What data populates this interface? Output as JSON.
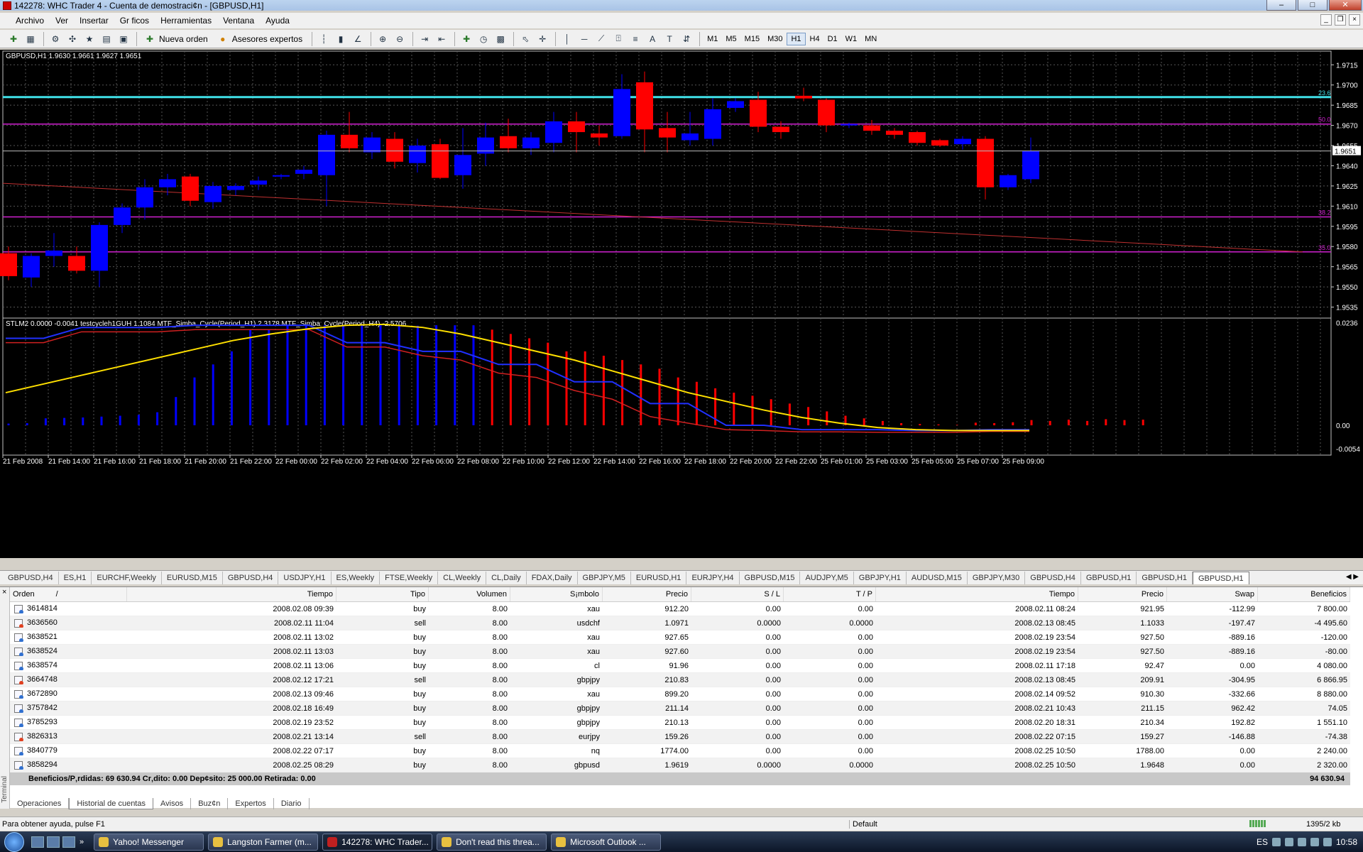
{
  "window": {
    "title": "142278: WHC Trader 4 - Cuenta de demostraci¢n - [GBPUSD,H1]"
  },
  "menu": [
    "Archivo",
    "Ver",
    "Insertar",
    "Gr ficos",
    "Herramientas",
    "Ventana",
    "Ayuda"
  ],
  "toolbar": {
    "new_order": "Nueva orden",
    "experts": "Asesores expertos",
    "timeframes": [
      "M1",
      "M5",
      "M15",
      "M30",
      "H1",
      "H4",
      "D1",
      "W1",
      "MN"
    ],
    "active_timeframe": "H1"
  },
  "chart_data": [
    {
      "type": "candlestick",
      "header": "GBPUSD,H1  1.9630 1.9661 1.9627 1.9651",
      "y_ticks": [
        "1.9715",
        "1.9700",
        "1.9685",
        "1.9670",
        "1.9655",
        "1.9640",
        "1.9625",
        "1.9610",
        "1.9595",
        "1.9580",
        "1.9565",
        "1.9550",
        "1.9535"
      ],
      "ylim": [
        1.953,
        1.9722
      ],
      "current_price": "1.9651",
      "fib_labels": [
        "23.6",
        "50.0",
        "38.2",
        "35.0"
      ],
      "levels": [
        {
          "label": "23.6",
          "value": 1.9691,
          "color": "#40e0e8"
        },
        {
          "label": "50.0",
          "value": 1.9671,
          "color": "#d020d0"
        },
        {
          "label": "38.2",
          "value": 1.9602,
          "color": "#d020d0"
        },
        {
          "label": "35.0",
          "value": 1.9576,
          "color": "#d020d0"
        }
      ],
      "trendline": {
        "from": 1.9627,
        "to": 1.9576,
        "color": "#c03030"
      },
      "candles": [
        {
          "o": 1.9575,
          "h": 1.958,
          "l": 1.9555,
          "c": 1.9558
        },
        {
          "o": 1.9557,
          "h": 1.9575,
          "l": 1.955,
          "c": 1.9573
        },
        {
          "o": 1.9573,
          "h": 1.959,
          "l": 1.9565,
          "c": 1.9577
        },
        {
          "o": 1.9573,
          "h": 1.958,
          "l": 1.956,
          "c": 1.9562
        },
        {
          "o": 1.9562,
          "h": 1.9598,
          "l": 1.955,
          "c": 1.9596
        },
        {
          "o": 1.9596,
          "h": 1.9612,
          "l": 1.959,
          "c": 1.9609
        },
        {
          "o": 1.9609,
          "h": 1.963,
          "l": 1.96,
          "c": 1.9624
        },
        {
          "o": 1.9624,
          "h": 1.9634,
          "l": 1.9618,
          "c": 1.963
        },
        {
          "o": 1.9632,
          "h": 1.9634,
          "l": 1.961,
          "c": 1.9614
        },
        {
          "o": 1.9613,
          "h": 1.9628,
          "l": 1.9608,
          "c": 1.9625
        },
        {
          "o": 1.9622,
          "h": 1.9627,
          "l": 1.9618,
          "c": 1.9625
        },
        {
          "o": 1.9626,
          "h": 1.9632,
          "l": 1.9622,
          "c": 1.9629
        },
        {
          "o": 1.9632,
          "h": 1.9634,
          "l": 1.963,
          "c": 1.9633
        },
        {
          "o": 1.9634,
          "h": 1.964,
          "l": 1.963,
          "c": 1.9637
        },
        {
          "o": 1.9633,
          "h": 1.9666,
          "l": 1.961,
          "c": 1.9663
        },
        {
          "o": 1.9663,
          "h": 1.968,
          "l": 1.965,
          "c": 1.9653
        },
        {
          "o": 1.965,
          "h": 1.9665,
          "l": 1.9645,
          "c": 1.9661
        },
        {
          "o": 1.966,
          "h": 1.9665,
          "l": 1.9638,
          "c": 1.9643
        },
        {
          "o": 1.9642,
          "h": 1.966,
          "l": 1.9635,
          "c": 1.9655
        },
        {
          "o": 1.9656,
          "h": 1.966,
          "l": 1.963,
          "c": 1.9631
        },
        {
          "o": 1.9633,
          "h": 1.9668,
          "l": 1.9623,
          "c": 1.9648
        },
        {
          "o": 1.9649,
          "h": 1.9672,
          "l": 1.964,
          "c": 1.9661
        },
        {
          "o": 1.9662,
          "h": 1.9675,
          "l": 1.965,
          "c": 1.9653
        },
        {
          "o": 1.9653,
          "h": 1.9665,
          "l": 1.9648,
          "c": 1.9661
        },
        {
          "o": 1.9657,
          "h": 1.968,
          "l": 1.965,
          "c": 1.9673
        },
        {
          "o": 1.9673,
          "h": 1.968,
          "l": 1.965,
          "c": 1.9665
        },
        {
          "o": 1.9664,
          "h": 1.967,
          "l": 1.9655,
          "c": 1.9661
        },
        {
          "o": 1.9662,
          "h": 1.9708,
          "l": 1.966,
          "c": 1.9697
        },
        {
          "o": 1.9702,
          "h": 1.971,
          "l": 1.965,
          "c": 1.9667
        },
        {
          "o": 1.9668,
          "h": 1.968,
          "l": 1.965,
          "c": 1.9661
        },
        {
          "o": 1.9659,
          "h": 1.968,
          "l": 1.9655,
          "c": 1.9664
        },
        {
          "o": 1.966,
          "h": 1.969,
          "l": 1.9655,
          "c": 1.9682
        },
        {
          "o": 1.9683,
          "h": 1.969,
          "l": 1.968,
          "c": 1.9688
        },
        {
          "o": 1.9689,
          "h": 1.9695,
          "l": 1.9665,
          "c": 1.9669
        },
        {
          "o": 1.9669,
          "h": 1.9673,
          "l": 1.966,
          "c": 1.9665
        },
        {
          "o": 1.9692,
          "h": 1.9698,
          "l": 1.9688,
          "c": 1.969
        },
        {
          "o": 1.9689,
          "h": 1.969,
          "l": 1.9665,
          "c": 1.967
        },
        {
          "o": 1.967,
          "h": 1.9672,
          "l": 1.9668,
          "c": 1.9671
        },
        {
          "o": 1.967,
          "h": 1.9674,
          "l": 1.9663,
          "c": 1.9666
        },
        {
          "o": 1.9666,
          "h": 1.9668,
          "l": 1.966,
          "c": 1.9663
        },
        {
          "o": 1.9665,
          "h": 1.9666,
          "l": 1.9655,
          "c": 1.9657
        },
        {
          "o": 1.9659,
          "h": 1.966,
          "l": 1.9654,
          "c": 1.9655
        },
        {
          "o": 1.9656,
          "h": 1.9662,
          "l": 1.9652,
          "c": 1.966
        },
        {
          "o": 1.966,
          "h": 1.9662,
          "l": 1.9615,
          "c": 1.9624
        },
        {
          "o": 1.9624,
          "h": 1.9634,
          "l": 1.9622,
          "c": 1.9633
        },
        {
          "o": 1.963,
          "h": 1.9661,
          "l": 1.9627,
          "c": 1.9651
        }
      ]
    },
    {
      "type": "line",
      "header": "STLM2 0.0000 -0.0041  testcycleh1GUH 1.1084  MTF_Simba_Cycle(Period_H1) 2.3178  MTF_Simba_Cycle(Period_H4) -2.5706",
      "y_ticks": [
        "0.0236",
        "0.00",
        "-0.0054"
      ],
      "ylim": [
        -0.0062,
        0.024
      ],
      "histogram": [
        0.0004,
        0.0005,
        0.0016,
        0.0017,
        0.0018,
        0.002,
        0.0022,
        0.0024,
        0.003,
        0.0065,
        0.011,
        0.014,
        0.017,
        0.022,
        0.022,
        0.023,
        0.023,
        0.023,
        0.023,
        0.023,
        0.023,
        0.0228,
        0.0229,
        0.023,
        0.023,
        0.023,
        0.022,
        0.021,
        0.02,
        0.019,
        0.017,
        0.017,
        0.016,
        0.015,
        0.014,
        0.013,
        0.011,
        0.01,
        0.0085,
        0.0075,
        0.0068,
        0.006,
        0.005,
        0.0042,
        0.0032,
        0.0022,
        0.0016,
        0.001,
        0.0005,
        0.0003,
        0.0002,
        0.0001,
        0.0006,
        0.0005,
        0.0007,
        0.0012,
        0.001,
        0.0013,
        0.001,
        0.0014,
        0.0012,
        0.0013
      ],
      "histogram_sign": [
        1,
        1,
        1,
        1,
        1,
        1,
        1,
        1,
        1,
        1,
        1,
        1,
        1,
        1,
        1,
        1,
        1,
        1,
        1,
        1,
        1,
        1,
        1,
        1,
        1,
        1,
        -1,
        -1,
        -1,
        -1,
        -1,
        -1,
        -1,
        -1,
        -1,
        -1,
        -1,
        -1,
        -1,
        -1,
        -1,
        -1,
        -1,
        -1,
        -1,
        -1,
        -1,
        -1,
        -1,
        -1,
        -1,
        -1,
        -1,
        -1,
        -1,
        -1,
        -1,
        -1,
        -1,
        -1,
        -1,
        -1
      ],
      "yellow_line": [
        0.0075,
        0.0095,
        0.0115,
        0.0135,
        0.0155,
        0.0175,
        0.0195,
        0.021,
        0.0222,
        0.023,
        0.0232,
        0.0225,
        0.021,
        0.019,
        0.017,
        0.015,
        0.0125,
        0.01,
        0.0075,
        0.0055,
        0.0035,
        0.0018,
        0.0005,
        -0.0005,
        -0.001,
        -0.0012,
        -0.0012,
        -0.0012
      ],
      "blue_line": [
        0.02,
        0.02,
        0.0225,
        0.0225,
        0.0225,
        0.023,
        0.023,
        0.023,
        0.023,
        0.019,
        0.019,
        0.017,
        0.017,
        0.014,
        0.014,
        0.01,
        0.01,
        0.005,
        0.005,
        0.0,
        0.0,
        -0.001,
        -0.001,
        -0.001,
        -0.0012,
        -0.0012,
        -0.001,
        -0.001
      ],
      "red_line": [
        0.019,
        0.019,
        0.0215,
        0.0215,
        0.0215,
        0.022,
        0.022,
        0.022,
        0.022,
        0.018,
        0.018,
        0.016,
        0.015,
        0.012,
        0.011,
        0.008,
        0.006,
        0.002,
        0.0005,
        -0.001,
        -0.0012,
        -0.0015,
        -0.0015,
        -0.0016,
        -0.0016,
        -0.0016,
        -0.0014,
        -0.0014
      ]
    }
  ],
  "x_labels": [
    "21 Feb 2008",
    "21 Feb 14:00",
    "21 Feb 16:00",
    "21 Feb 18:00",
    "21 Feb 20:00",
    "21 Feb 22:00",
    "22 Feb 00:00",
    "22 Feb 02:00",
    "22 Feb 04:00",
    "22 Feb 06:00",
    "22 Feb 08:00",
    "22 Feb 10:00",
    "22 Feb 12:00",
    "22 Feb 14:00",
    "22 Feb 16:00",
    "22 Feb 18:00",
    "22 Feb 20:00",
    "22 Feb 22:00",
    "25 Feb 01:00",
    "25 Feb 03:00",
    "25 Feb 05:00",
    "25 Feb 07:00",
    "25 Feb 09:00"
  ],
  "chart_tabs": [
    "GBPUSD,H4",
    "ES,H1",
    "EURCHF,Weekly",
    "EURUSD,M15",
    "GBPUSD,H4",
    "USDJPY,H1",
    "ES,Weekly",
    "FTSE,Weekly",
    "CL,Weekly",
    "CL,Daily",
    "FDAX,Daily",
    "GBPJPY,M5",
    "EURUSD,H1",
    "EURJPY,H4",
    "GBPUSD,M15",
    "AUDJPY,M5",
    "GBPJPY,H1",
    "AUDUSD,M15",
    "GBPJPY,M30",
    "GBPUSD,H4",
    "GBPUSD,H1",
    "GBPUSD,H1",
    "GBPUSD,H1"
  ],
  "terminal": {
    "side_label": "Terminal",
    "columns": [
      "Orden",
      "Tiempo",
      "Tipo",
      "Volumen",
      "S¡mbolo",
      "Precio",
      "S / L",
      "T / P",
      "Tiempo",
      "Precio",
      "Swap",
      "Beneficios"
    ],
    "sort_marker": "/",
    "rows": [
      [
        "3614814",
        "2008.02.08 09:39",
        "buy",
        "8.00",
        "xau",
        "912.20",
        "0.00",
        "0.00",
        "2008.02.11 08:24",
        "921.95",
        "-112.99",
        "7 800.00"
      ],
      [
        "3636560",
        "2008.02.11 11:04",
        "sell",
        "8.00",
        "usdchf",
        "1.0971",
        "0.0000",
        "0.0000",
        "2008.02.13 08:45",
        "1.1033",
        "-197.47",
        "-4 495.60"
      ],
      [
        "3638521",
        "2008.02.11 13:02",
        "buy",
        "8.00",
        "xau",
        "927.65",
        "0.00",
        "0.00",
        "2008.02.19 23:54",
        "927.50",
        "-889.16",
        "-120.00"
      ],
      [
        "3638524",
        "2008.02.11 13:03",
        "buy",
        "8.00",
        "xau",
        "927.60",
        "0.00",
        "0.00",
        "2008.02.19 23:54",
        "927.50",
        "-889.16",
        "-80.00"
      ],
      [
        "3638574",
        "2008.02.11 13:06",
        "buy",
        "8.00",
        "cl",
        "91.96",
        "0.00",
        "0.00",
        "2008.02.11 17:18",
        "92.47",
        "0.00",
        "4 080.00"
      ],
      [
        "3664748",
        "2008.02.12 17:21",
        "sell",
        "8.00",
        "gbpjpy",
        "210.83",
        "0.00",
        "0.00",
        "2008.02.13 08:45",
        "209.91",
        "-304.95",
        "6 866.95"
      ],
      [
        "3672890",
        "2008.02.13 09:46",
        "buy",
        "8.00",
        "xau",
        "899.20",
        "0.00",
        "0.00",
        "2008.02.14 09:52",
        "910.30",
        "-332.66",
        "8 880.00"
      ],
      [
        "3757842",
        "2008.02.18 16:49",
        "buy",
        "8.00",
        "gbpjpy",
        "211.14",
        "0.00",
        "0.00",
        "2008.02.21 10:43",
        "211.15",
        "962.42",
        "74.05"
      ],
      [
        "3785293",
        "2008.02.19 23:52",
        "buy",
        "8.00",
        "gbpjpy",
        "210.13",
        "0.00",
        "0.00",
        "2008.02.20 18:31",
        "210.34",
        "192.82",
        "1 551.10"
      ],
      [
        "3826313",
        "2008.02.21 13:14",
        "sell",
        "8.00",
        "eurjpy",
        "159.26",
        "0.00",
        "0.00",
        "2008.02.22 07:15",
        "159.27",
        "-146.88",
        "-74.38"
      ],
      [
        "3840779",
        "2008.02.22 07:17",
        "buy",
        "8.00",
        "nq",
        "1774.00",
        "0.00",
        "0.00",
        "2008.02.25 10:50",
        "1788.00",
        "0.00",
        "2 240.00"
      ],
      [
        "3858294",
        "2008.02.25 08:29",
        "buy",
        "8.00",
        "gbpusd",
        "1.9619",
        "0.0000",
        "0.0000",
        "2008.02.25 10:50",
        "1.9648",
        "0.00",
        "2 320.00"
      ]
    ],
    "balance_text": "Beneficios/P‚rdidas: 69 630.94  Cr‚dito: 0.00  Dep¢sito: 25 000.00  Retirada: 0.00",
    "balance_total": "94 630.94",
    "bottom_tabs": [
      "Operaciones",
      "Historial de cuentas",
      "Avisos",
      "Buz¢n",
      "Expertos",
      "Diario"
    ],
    "active_bottom_tab": "Historial de cuentas"
  },
  "statusbar": {
    "help": "Para obtener ayuda, pulse F1",
    "profile": "Default",
    "traffic": "1395/2 kb"
  },
  "taskbar": {
    "items": [
      "Yahoo! Messenger",
      "Langston Farmer (m...",
      "142278: WHC Trader...",
      "Don't read this threa...",
      "Microsoft Outlook ..."
    ],
    "lang": "ES",
    "clock": "10:58"
  }
}
